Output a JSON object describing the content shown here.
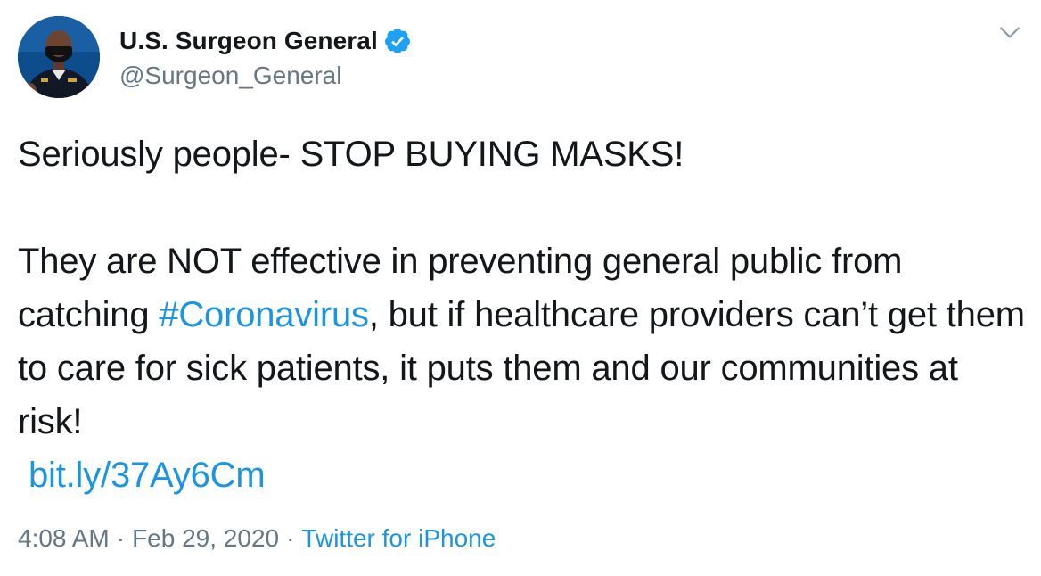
{
  "author": {
    "display_name": "U.S. Surgeon General",
    "handle": "@Surgeon_General"
  },
  "icons": {
    "verified": "verified-badge-icon",
    "caret": "chevron-down-icon"
  },
  "tweet": {
    "line1": "Seriously people- STOP BUYING MASKS!",
    "para2_before": "They are NOT effective in preventing general public from catching ",
    "hashtag": "#Coronavirus",
    "para2_after": ", but if healthcare providers can’t get them to care for sick patients, it puts them and our communities at risk!",
    "link": "bit.ly/37Ay6Cm"
  },
  "meta": {
    "time": "4:08 AM",
    "separator": "·",
    "date": "Feb 29, 2020",
    "source": "Twitter for iPhone"
  },
  "colors": {
    "link": "#1b95e0",
    "secondary_text": "#657786",
    "primary_text": "#14171a"
  }
}
